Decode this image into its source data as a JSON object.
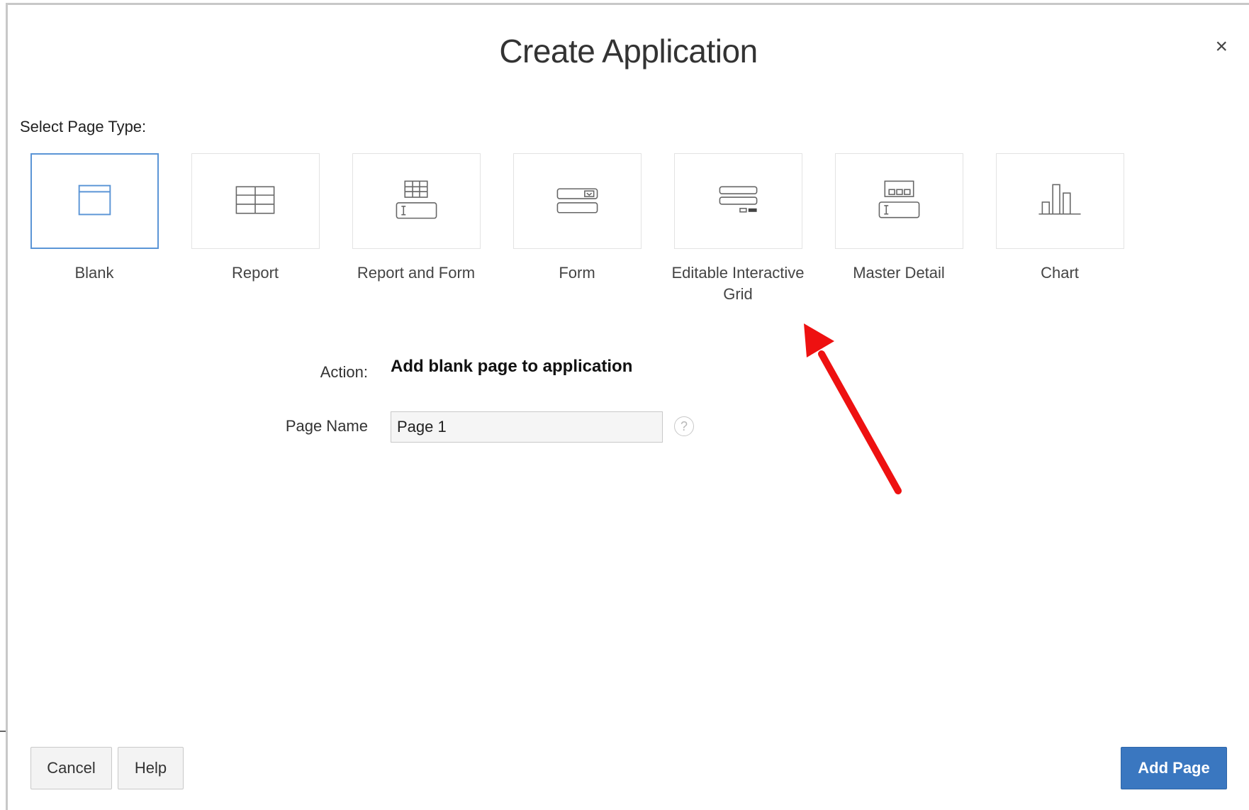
{
  "dialog": {
    "title": "Create Application",
    "close_label": "×"
  },
  "page_type": {
    "label": "Select Page Type:",
    "options": [
      {
        "label": "Blank",
        "icon": "blank-page-icon",
        "selected": true
      },
      {
        "label": "Report",
        "icon": "report-grid-icon",
        "selected": false
      },
      {
        "label": "Report and Form",
        "icon": "report-and-form-icon",
        "selected": false
      },
      {
        "label": "Form",
        "icon": "form-icon",
        "selected": false
      },
      {
        "label": "Editable Interactive Grid",
        "icon": "editable-grid-icon",
        "selected": false
      },
      {
        "label": "Master Detail",
        "icon": "master-detail-icon",
        "selected": false
      },
      {
        "label": "Chart",
        "icon": "bar-chart-icon",
        "selected": false
      }
    ]
  },
  "form": {
    "action_label": "Action:",
    "action_value": "Add blank page to application",
    "page_name_label": "Page Name",
    "page_name_value": "Page 1",
    "help_glyph": "?"
  },
  "footer": {
    "cancel_label": "Cancel",
    "help_label": "Help",
    "add_label": "Add Page"
  },
  "colors": {
    "accent": "#3a77c0",
    "selected_border": "#5b95d6",
    "annotation_arrow": "#ee1111"
  }
}
